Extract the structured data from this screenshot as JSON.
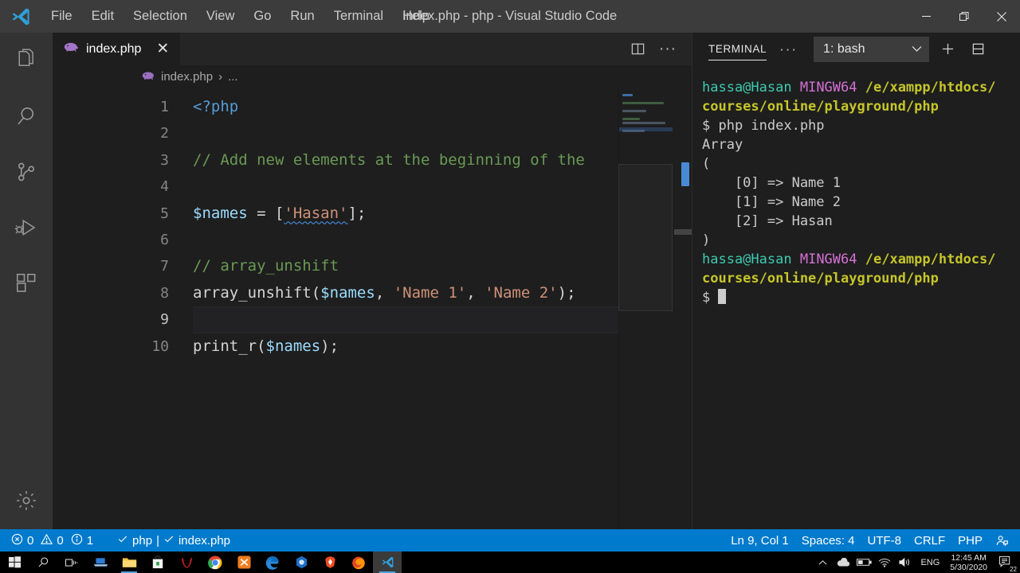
{
  "window": {
    "title": "index.php - php - Visual Studio Code",
    "minimize_label": "—",
    "maximize_label": "❐",
    "close_label": "✕"
  },
  "menubar": {
    "items": [
      {
        "label": "File"
      },
      {
        "label": "Edit"
      },
      {
        "label": "Selection"
      },
      {
        "label": "View"
      },
      {
        "label": "Go"
      },
      {
        "label": "Run"
      },
      {
        "label": "Terminal"
      },
      {
        "label": "Help"
      }
    ]
  },
  "activitybar": {
    "items": [
      {
        "name": "explorer-icon",
        "title": "Explorer"
      },
      {
        "name": "search-icon",
        "title": "Search"
      },
      {
        "name": "source-control-icon",
        "title": "Source Control"
      },
      {
        "name": "run-debug-icon",
        "title": "Run and Debug"
      },
      {
        "name": "extensions-icon",
        "title": "Extensions"
      },
      {
        "name": "gear-icon",
        "title": "Manage"
      }
    ]
  },
  "editor": {
    "tab": {
      "label": "index.php",
      "close_label": "✕",
      "icon": "php-elephant-icon"
    },
    "actions": {
      "split_label": "split-editor-icon",
      "more_label": "···"
    },
    "breadcrumb": {
      "file": "index.php",
      "separator": "›",
      "ellipsis": "..."
    },
    "lines": [
      {
        "num": "1",
        "active": false,
        "tokens": [
          {
            "t": "<?php",
            "c": "tok-tag"
          }
        ]
      },
      {
        "num": "2",
        "active": false,
        "tokens": []
      },
      {
        "num": "3",
        "active": false,
        "tokens": [
          {
            "t": "// Add new elements at the beginning of the",
            "c": "tok-cmt"
          }
        ]
      },
      {
        "num": "4",
        "active": false,
        "tokens": []
      },
      {
        "num": "5",
        "active": false,
        "tokens": [
          {
            "t": "$names",
            "c": "tok-var"
          },
          {
            "t": " = [",
            "c": "tok-plain"
          },
          {
            "t": "'Hasan'",
            "c": "tok-str squiggle"
          },
          {
            "t": "];",
            "c": "tok-plain"
          }
        ]
      },
      {
        "num": "6",
        "active": false,
        "tokens": []
      },
      {
        "num": "7",
        "active": false,
        "tokens": [
          {
            "t": "// array_unshift",
            "c": "tok-cmt"
          }
        ]
      },
      {
        "num": "8",
        "active": false,
        "tokens": [
          {
            "t": "array_unshift",
            "c": "tok-plain"
          },
          {
            "t": "(",
            "c": "tok-punc"
          },
          {
            "t": "$names",
            "c": "tok-var"
          },
          {
            "t": ", ",
            "c": "tok-plain"
          },
          {
            "t": "'Name 1'",
            "c": "tok-str"
          },
          {
            "t": ", ",
            "c": "tok-plain"
          },
          {
            "t": "'Name 2'",
            "c": "tok-str"
          },
          {
            "t": ");",
            "c": "tok-plain"
          }
        ]
      },
      {
        "num": "9",
        "active": true,
        "tokens": []
      },
      {
        "num": "10",
        "active": false,
        "tokens": [
          {
            "t": "print_r",
            "c": "tok-plain"
          },
          {
            "t": "(",
            "c": "tok-punc"
          },
          {
            "t": "$names",
            "c": "tok-var"
          },
          {
            "t": ");",
            "c": "tok-plain"
          }
        ]
      }
    ]
  },
  "panel": {
    "title": "TERMINAL",
    "more_label": "···",
    "terminal_select": {
      "value": "1: bash",
      "chevron": "∨",
      "options": [
        "1: bash"
      ]
    },
    "new_terminal_label": "+",
    "split_terminal_label": "split-terminal-icon",
    "terminal_lines": [
      {
        "segments": [
          {
            "text": "hassa@Hasan",
            "c": "t-teal"
          },
          {
            "text": " ",
            "c": "t-white"
          },
          {
            "text": "MINGW64",
            "c": "t-mag"
          },
          {
            "text": " ",
            "c": "t-white"
          },
          {
            "text": "/e/xampp/htdocs/",
            "c": "t-yel"
          }
        ]
      },
      {
        "segments": [
          {
            "text": "courses/online/playground/php",
            "c": "t-yel"
          }
        ]
      },
      {
        "segments": [
          {
            "text": "$ php index.php",
            "c": "t-white"
          }
        ]
      },
      {
        "segments": [
          {
            "text": "Array",
            "c": "t-white"
          }
        ]
      },
      {
        "segments": [
          {
            "text": "(",
            "c": "t-white"
          }
        ]
      },
      {
        "segments": [
          {
            "text": "    [0] => Name 1",
            "c": "t-white"
          }
        ]
      },
      {
        "segments": [
          {
            "text": "    [1] => Name 2",
            "c": "t-white"
          }
        ]
      },
      {
        "segments": [
          {
            "text": "    [2] => Hasan",
            "c": "t-white"
          }
        ]
      },
      {
        "segments": [
          {
            "text": ")",
            "c": "t-white"
          }
        ]
      },
      {
        "segments": [
          {
            "text": "",
            "c": "t-white"
          }
        ]
      },
      {
        "segments": [
          {
            "text": "hassa@Hasan",
            "c": "t-teal"
          },
          {
            "text": " ",
            "c": "t-white"
          },
          {
            "text": "MINGW64",
            "c": "t-mag"
          },
          {
            "text": " ",
            "c": "t-white"
          },
          {
            "text": "/e/xampp/htdocs/",
            "c": "t-yel"
          }
        ]
      },
      {
        "segments": [
          {
            "text": "courses/online/playground/php",
            "c": "t-yel"
          }
        ]
      },
      {
        "segments": [
          {
            "text": "$ ",
            "c": "t-white"
          }
        ],
        "cursor": true
      }
    ]
  },
  "statusbar": {
    "errors": "0",
    "warnings": "0",
    "infos": "1",
    "php_status": "php",
    "php_separator": "|",
    "file_status": "index.php",
    "cursor_position": "Ln 9, Col 1",
    "spaces": "Spaces: 4",
    "encoding": "UTF-8",
    "eol": "CRLF",
    "language": "PHP",
    "feedback": "feedback-smiley-icon"
  },
  "taskbar": {
    "icons": [
      {
        "name": "windows-start-icon",
        "active": false,
        "running": false
      },
      {
        "name": "search-icon",
        "active": false,
        "running": false
      },
      {
        "name": "task-view-icon",
        "active": false,
        "running": false
      },
      {
        "name": "remote-desktop-icon",
        "active": false,
        "running": false
      },
      {
        "name": "file-explorer-icon",
        "active": false,
        "running": true
      },
      {
        "name": "microsoft-store-icon",
        "active": false,
        "running": false
      },
      {
        "name": "alienware-icon",
        "active": false,
        "running": false
      },
      {
        "name": "google-chrome-icon",
        "active": false,
        "running": true
      },
      {
        "name": "xampp-icon",
        "active": false,
        "running": false
      },
      {
        "name": "microsoft-edge-icon",
        "active": false,
        "running": false
      },
      {
        "name": "blue-hexagon-icon",
        "active": false,
        "running": false
      },
      {
        "name": "brave-browser-icon",
        "active": false,
        "running": false
      },
      {
        "name": "firefox-icon",
        "active": false,
        "running": false
      },
      {
        "name": "vscode-icon",
        "active": true,
        "running": true
      }
    ],
    "tray": {
      "chevron": "∧",
      "language": "ENG",
      "time": "12:45 AM",
      "date": "5/30/2020",
      "notification_count": "22"
    }
  },
  "colors": {
    "accent": "#007acc",
    "titlebar_bg": "#3c3c3c",
    "activitybar_bg": "#333333",
    "editor_bg": "#1e1e1e",
    "tabbar_bg": "#252526"
  }
}
